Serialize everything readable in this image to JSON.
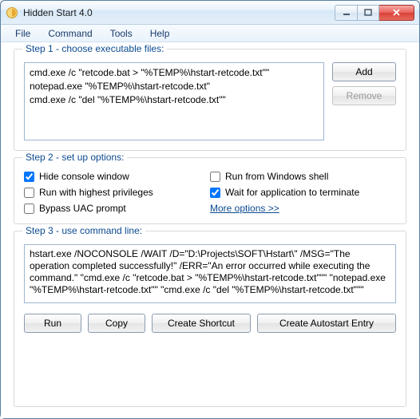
{
  "window": {
    "title": "Hidden Start 4.0"
  },
  "menu": {
    "file": "File",
    "command": "Command",
    "tools": "Tools",
    "help": "Help"
  },
  "step1": {
    "label": "Step 1 - choose executable files:",
    "lines": {
      "l0": "cmd.exe /c \"retcode.bat > \"%TEMP%\\hstart-retcode.txt\"\"",
      "l1": "notepad.exe \"%TEMP%\\hstart-retcode.txt\"",
      "l2": "cmd.exe /c \"del \"%TEMP%\\hstart-retcode.txt\"\""
    },
    "add": "Add",
    "remove": "Remove"
  },
  "step2": {
    "label": "Step 2 - set up options:",
    "hide_console": "Hide console window",
    "run_from_shell": "Run from Windows shell",
    "highest_priv": "Run with highest privileges",
    "wait_term": "Wait for application to terminate",
    "bypass_uac": "Bypass UAC prompt",
    "more": "More options >>"
  },
  "step3": {
    "label": "Step 3 - use command line:",
    "cmd": "hstart.exe /NOCONSOLE /WAIT /D=\"D:\\Projects\\SOFT\\Hstart\\\" /MSG=\"The operation completed successfully!\" /ERR=\"An error occurred while executing the command.\" \"cmd.exe /c \"retcode.bat > \"%TEMP%\\hstart-retcode.txt\"\"\" \"notepad.exe \"%TEMP%\\hstart-retcode.txt\"\" \"cmd.exe /c \"del \"%TEMP%\\hstart-retcode.txt\"\"\""
  },
  "buttons": {
    "run": "Run",
    "copy": "Copy",
    "shortcut": "Create Shortcut",
    "autostart": "Create Autostart Entry"
  }
}
